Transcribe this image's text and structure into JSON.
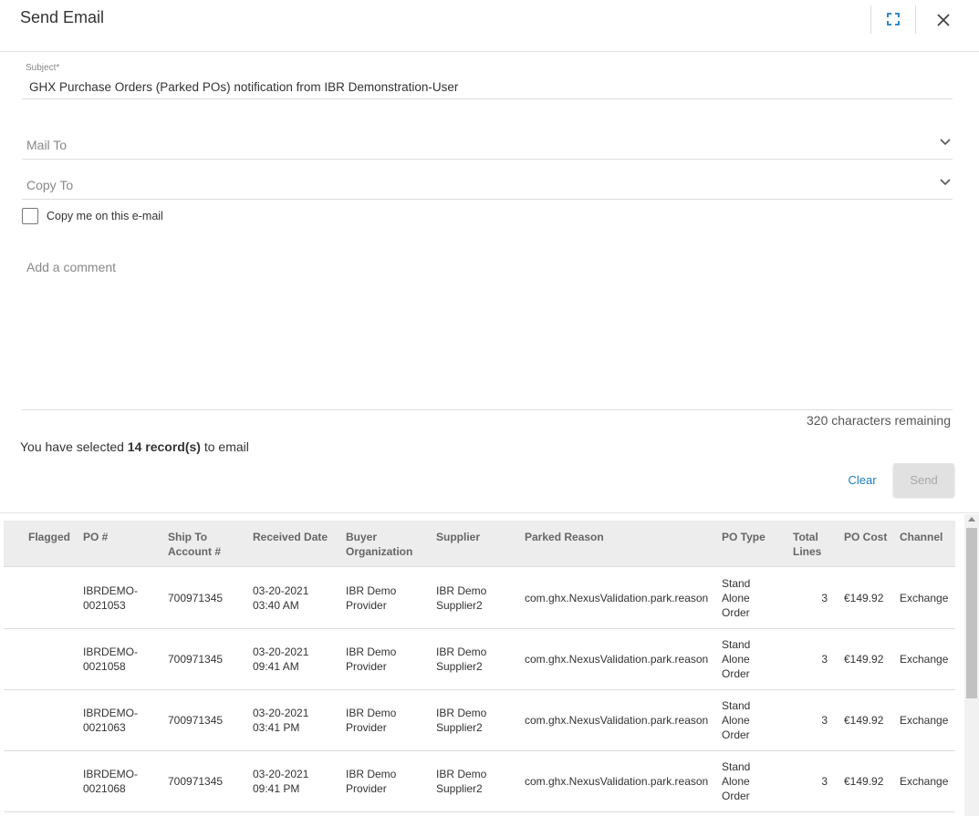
{
  "dialog": {
    "title": "Send Email"
  },
  "form": {
    "subject_label": "Subject",
    "subject_required_mark": "*",
    "subject_value": "GHX Purchase Orders (Parked POs) notification from IBR Demonstration-User",
    "mail_to_placeholder": "Mail To",
    "copy_to_placeholder": "Copy To",
    "copy_me_label": "Copy me on this e-mail",
    "comment_placeholder": "Add a comment",
    "chars_remaining": "320 characters remaining"
  },
  "selection": {
    "prefix": "You have selected ",
    "count": "14 record(s)",
    "suffix": " to email"
  },
  "actions": {
    "clear_label": "Clear",
    "send_label": "Send"
  },
  "table": {
    "headers": {
      "flagged": "Flagged",
      "po": "PO #",
      "ship_to_1": "Ship To",
      "ship_to_2": "Account #",
      "received": "Received Date",
      "buyer_1": "Buyer",
      "buyer_2": "Organization",
      "supplier": "Supplier",
      "reason": "Parked Reason",
      "type": "PO Type",
      "lines_1": "Total",
      "lines_2": "Lines",
      "cost": "PO Cost",
      "channel": "Channel"
    },
    "rows": [
      {
        "po_1": "IBRDEMO-",
        "po_2": "0021053",
        "account": "700971345",
        "date": "03-20-2021",
        "time": "03:40 AM",
        "buyer_1": "IBR Demo",
        "buyer_2": "Provider",
        "supplier_1": "IBR Demo",
        "supplier_2": "Supplier2",
        "reason": "com.ghx.NexusValidation.park.reason",
        "type_1": "Stand",
        "type_2": "Alone",
        "type_3": "Order",
        "lines": "3",
        "cost": "€149.92",
        "channel": "Exchange"
      },
      {
        "po_1": "IBRDEMO-",
        "po_2": "0021058",
        "account": "700971345",
        "date": "03-20-2021",
        "time": "09:41 AM",
        "buyer_1": "IBR Demo",
        "buyer_2": "Provider",
        "supplier_1": "IBR Demo",
        "supplier_2": "Supplier2",
        "reason": "com.ghx.NexusValidation.park.reason",
        "type_1": "Stand",
        "type_2": "Alone",
        "type_3": "Order",
        "lines": "3",
        "cost": "€149.92",
        "channel": "Exchange"
      },
      {
        "po_1": "IBRDEMO-",
        "po_2": "0021063",
        "account": "700971345",
        "date": "03-20-2021",
        "time": "03:41 PM",
        "buyer_1": "IBR Demo",
        "buyer_2": "Provider",
        "supplier_1": "IBR Demo",
        "supplier_2": "Supplier2",
        "reason": "com.ghx.NexusValidation.park.reason",
        "type_1": "Stand",
        "type_2": "Alone",
        "type_3": "Order",
        "lines": "3",
        "cost": "€149.92",
        "channel": "Exchange"
      },
      {
        "po_1": "IBRDEMO-",
        "po_2": "0021068",
        "account": "700971345",
        "date": "03-20-2021",
        "time": "09:41 PM",
        "buyer_1": "IBR Demo",
        "buyer_2": "Provider",
        "supplier_1": "IBR Demo",
        "supplier_2": "Supplier2",
        "reason": "com.ghx.NexusValidation.park.reason",
        "type_1": "Stand",
        "type_2": "Alone",
        "type_3": "Order",
        "lines": "3",
        "cost": "€149.92",
        "channel": "Exchange"
      }
    ]
  },
  "icons": {
    "expand": "expand-icon",
    "close": "close-icon",
    "chevron": "chevron-down-icon"
  },
  "colors": {
    "accent": "#1a7dc4",
    "send_disabled_bg": "#e1e1e1",
    "table_header_bg": "#ededed"
  }
}
